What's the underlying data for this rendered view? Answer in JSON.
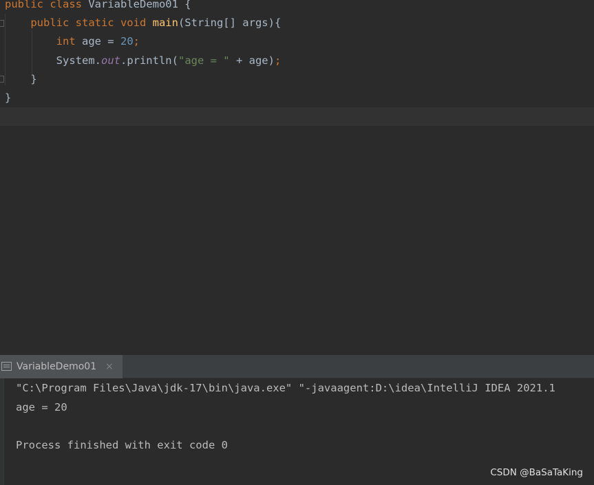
{
  "editor": {
    "lines": [
      [
        {
          "t": "public class ",
          "c": "kw"
        },
        {
          "t": "VariableDemo01 {",
          "c": "plain"
        }
      ],
      [
        {
          "t": "    ",
          "c": "plain"
        },
        {
          "t": "public static void ",
          "c": "kw"
        },
        {
          "t": "main",
          "c": "fn"
        },
        {
          "t": "(String[] args){",
          "c": "plain"
        }
      ],
      [
        {
          "t": "        ",
          "c": "plain"
        },
        {
          "t": "int ",
          "c": "kw"
        },
        {
          "t": "age = ",
          "c": "plain"
        },
        {
          "t": "20",
          "c": "num"
        },
        {
          "t": ";",
          "c": "kw"
        }
      ],
      [
        {
          "t": "        ",
          "c": "plain"
        },
        {
          "t": "System.",
          "c": "plain"
        },
        {
          "t": "out",
          "c": "field"
        },
        {
          "t": ".println(",
          "c": "plain"
        },
        {
          "t": "\"age = \"",
          "c": "str"
        },
        {
          "t": " + age)",
          "c": "plain"
        },
        {
          "t": ";",
          "c": "kw"
        }
      ],
      [
        {
          "t": "    }",
          "c": "plain"
        }
      ],
      [
        {
          "t": "}",
          "c": "plain"
        }
      ]
    ]
  },
  "run_panel": {
    "tab_label": "VariableDemo01",
    "close_glyph": "×",
    "output": [
      "\"C:\\Program Files\\Java\\jdk-17\\bin\\java.exe\" \"-javaagent:D:\\idea\\IntelliJ IDEA 2021.1",
      "age = 20",
      "",
      "Process finished with exit code 0"
    ]
  },
  "watermark": "CSDN @BaSaTaKing",
  "colors": {
    "background": "#2b2b2b",
    "keyword": "#cc7832",
    "function": "#ffc66d",
    "number": "#6897bb",
    "string": "#6a8759",
    "field": "#9876aa",
    "text": "#a9b7c6"
  }
}
